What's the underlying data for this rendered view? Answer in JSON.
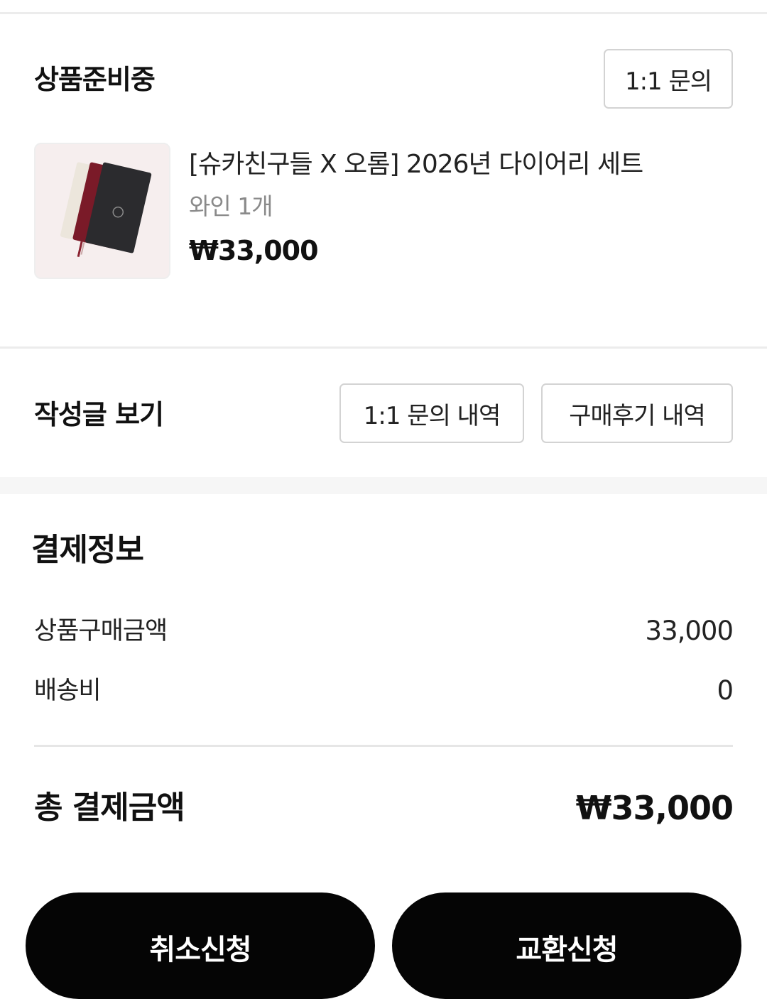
{
  "order": {
    "status": "상품준비중",
    "inquiry_button": "1:1 문의"
  },
  "product": {
    "name": "[슈카친구들 X 오롬] 2026년 다이어리 세트",
    "option": "와인 1개",
    "price": "₩33,000"
  },
  "posts": {
    "title": "작성글 보기",
    "inquiry_history_button": "1:1 문의 내역",
    "review_history_button": "구매후기 내역"
  },
  "payment": {
    "title": "결제정보",
    "rows": [
      {
        "label": "상품구매금액",
        "value": "33,000"
      },
      {
        "label": "배송비",
        "value": "0"
      }
    ],
    "total_label": "총 결제금액",
    "total_value": "₩33,000"
  },
  "actions": {
    "cancel_button": "취소신청",
    "exchange_button": "교환신청"
  },
  "colors": {
    "primary_button_bg": "#050505",
    "divider": "#ececec",
    "muted_text": "#8a8a8a"
  }
}
